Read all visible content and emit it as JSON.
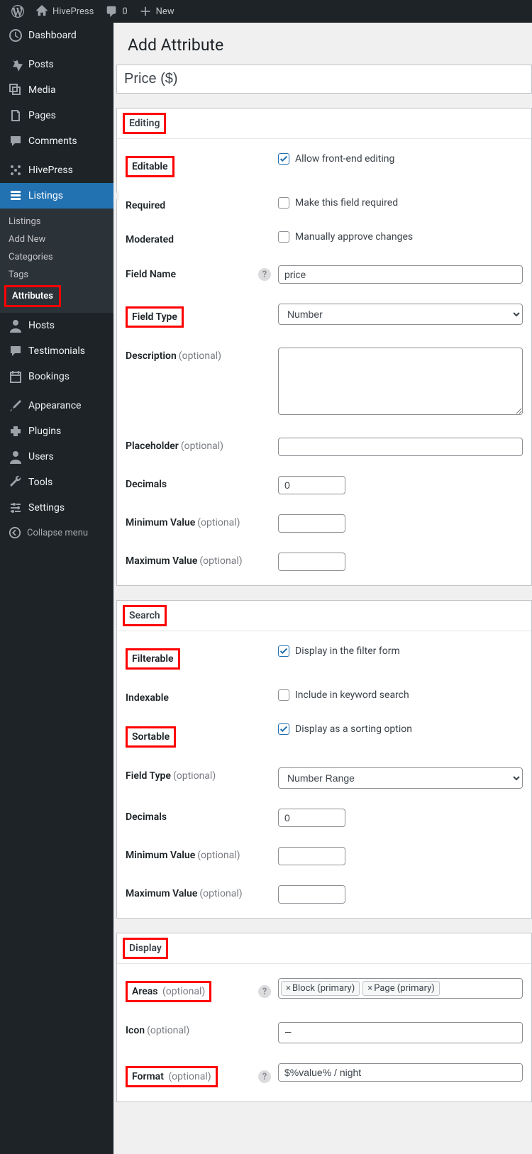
{
  "topbar": {
    "site_name": "HivePress",
    "comments_count": "0",
    "new_label": "New"
  },
  "sidebar": {
    "dashboard": "Dashboard",
    "posts": "Posts",
    "media": "Media",
    "pages": "Pages",
    "comments": "Comments",
    "hivepress": "HivePress",
    "listings": "Listings",
    "listings_sub": [
      "Listings",
      "Add New",
      "Categories",
      "Tags",
      "Attributes"
    ],
    "hosts": "Hosts",
    "testimonials": "Testimonials",
    "bookings": "Bookings",
    "appearance": "Appearance",
    "plugins": "Plugins",
    "users": "Users",
    "tools": "Tools",
    "settings": "Settings",
    "collapse": "Collapse menu"
  },
  "page": {
    "title": "Add Attribute",
    "attr_title_value": "Price ($)"
  },
  "editing": {
    "heading": "Editing",
    "editable_label": "Editable",
    "editable_desc": "Allow front-end editing",
    "required_label": "Required",
    "required_desc": "Make this field required",
    "moderated_label": "Moderated",
    "moderated_desc": "Manually approve changes",
    "fieldname_label": "Field Name",
    "fieldname_value": "price",
    "fieldtype_label": "Field Type",
    "fieldtype_value": "Number",
    "description_label": "Description",
    "placeholder_label": "Placeholder",
    "decimals_label": "Decimals",
    "decimals_value": "0",
    "minval_label": "Minimum Value",
    "maxval_label": "Maximum Value",
    "optional_text": "(optional)"
  },
  "searchbox": {
    "heading": "Search",
    "filterable_label": "Filterable",
    "filterable_desc": "Display in the filter form",
    "indexable_label": "Indexable",
    "indexable_desc": "Include in keyword search",
    "sortable_label": "Sortable",
    "sortable_desc": "Display as a sorting option",
    "fieldtype_label": "Field Type",
    "fieldtype_value": "Number Range",
    "decimals_label": "Decimals",
    "decimals_value": "0",
    "minval_label": "Minimum Value",
    "maxval_label": "Maximum Value",
    "optional_text": "(optional)"
  },
  "displaybox": {
    "heading": "Display",
    "areas_label": "Areas",
    "area_pill1": "Block (primary)",
    "area_pill2": "Page (primary)",
    "icon_label": "Icon",
    "icon_value": "—",
    "format_label": "Format",
    "format_value": "$%value% / night",
    "optional_text": "(optional)"
  }
}
